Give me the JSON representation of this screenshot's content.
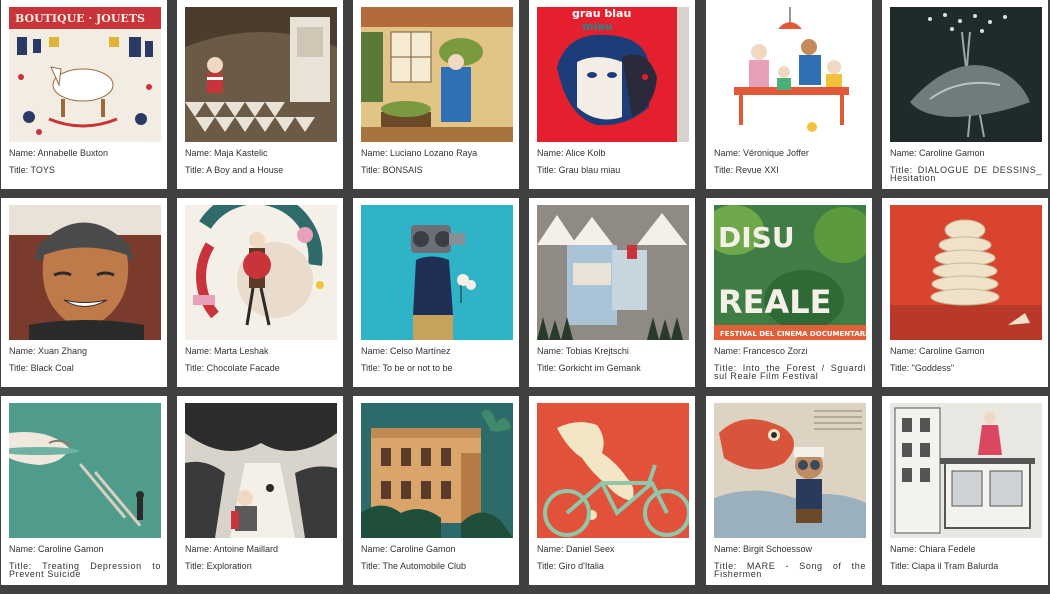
{
  "cards": [
    {
      "name": "Name: Annabelle Buxton",
      "title": "Title: TOYS",
      "icon": "toys-illustration-image",
      "bg": "#f3ece2",
      "accent": "#c9343a"
    },
    {
      "name": "Name: Maja Kastelic",
      "title": "Title: A Boy and a House",
      "icon": "boy-house-illustration-image",
      "bg": "#6b5a45",
      "accent": "#e9e2d6"
    },
    {
      "name": "Name: Luciano Lozano Raya",
      "title": "Title: BONSAIS",
      "icon": "bonsais-illustration-image",
      "bg": "#e3c487",
      "accent": "#7a9a3f"
    },
    {
      "name": "Name: Alice Kolb",
      "title": "Title: Grau blau miau",
      "icon": "grau-blau-miau-illustration-image",
      "bg": "#e4202e",
      "accent": "#1d3d7a"
    },
    {
      "name": "Name: Véronique Joffer",
      "title": "Title: Revue XXI",
      "icon": "revue-xxi-illustration-image",
      "bg": "#ffffff",
      "accent": "#e05a3a"
    },
    {
      "name": "Name: Caroline Gamon",
      "title": "Title: DIALOGUE DE DESSINS_ Hesitation",
      "icon": "dialogue-de-dessins-illustration-image",
      "bg": "#1f2a2b",
      "accent": "#9aa6a8"
    },
    {
      "name": "Name: Xuan Zhang",
      "title": "Title: Black Coal",
      "icon": "black-coal-illustration-image",
      "bg": "#7a3b2c",
      "accent": "#2a2a2a"
    },
    {
      "name": "Name: Marta Leshak",
      "title": "Title: Chocolate Facade",
      "icon": "chocolate-facade-illustration-image",
      "bg": "#f4f0e8",
      "accent": "#5b3a2a"
    },
    {
      "name": "Name: Celso Martínez",
      "title": "Title: To be or not to be",
      "icon": "to-be-or-not-to-be-illustration-image",
      "bg": "#2fb3c6",
      "accent": "#1f2f55"
    },
    {
      "name": "Name: Tobias Krejtschi",
      "title": "Title: Gorkicht im Gemank",
      "icon": "gorkicht-im-gemank-illustration-image",
      "bg": "#8f8a84",
      "accent": "#a8c4d6"
    },
    {
      "name": "Name: Francesco Zorzi",
      "title": "Title: Into the Forest / Sguardi sul Reale Film Festival",
      "icon": "into-the-forest-poster-image",
      "bg": "#3f7d45",
      "accent": "#e1603a"
    },
    {
      "name": "Name: Caroline Gamon",
      "title": "Title: \"Goddess\"",
      "icon": "goddess-illustration-image",
      "bg": "#d9442e",
      "accent": "#efe2c8"
    },
    {
      "name": "Name: Caroline Gamon",
      "title": "Title: Treating Depression to Prevent Suicide",
      "icon": "treating-depression-illustration-image",
      "bg": "#4f9c8d",
      "accent": "#efe8dc"
    },
    {
      "name": "Name: Antoine Maillard",
      "title": "Title: Exploration",
      "icon": "exploration-illustration-image",
      "bg": "#d8d4cc",
      "accent": "#2c2c2c"
    },
    {
      "name": "Name: Caroline Gamon",
      "title": "Title: The Automobile Club",
      "icon": "automobile-club-illustration-image",
      "bg": "#2c6b6a",
      "accent": "#d9a56b"
    },
    {
      "name": "Name: Daniel Seex",
      "title": "Title: Giro d'Italia",
      "icon": "giro-ditalia-illustration-image",
      "bg": "#e2523b",
      "accent": "#f2e6c4"
    },
    {
      "name": "Name: Birgit Schoessow",
      "title": "Title: MARE - Song of the Fishermen",
      "icon": "mare-illustration-image",
      "bg": "#dcd3c2",
      "accent": "#d8543a"
    },
    {
      "name": "Name: Chiara Fedele",
      "title": "Title: Ciapa il Tram Balurda",
      "icon": "ciapa-il-tram-illustration-image",
      "bg": "#e9e7e2",
      "accent": "#d94760"
    }
  ]
}
